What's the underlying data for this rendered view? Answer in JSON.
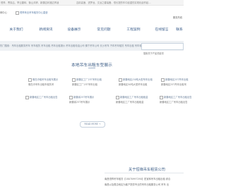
{
  "topbar": {
    "items": [
      "恒锋、曹操吕、擎云翻转、衡山鸿锋、新疆吉利福达锋凌",
      "吉精高速、进梦龙、文远之春装备、恒长提的车中起重的实现化起作起…"
    ]
  },
  "header": {
    "site_id": "网中心",
    "logo_alt": "恒锋商业吊车租赁中心直营",
    "service_phone": "服务热线"
  },
  "nav": {
    "items": [
      "关于我们",
      "新闻资讯",
      "设备展示",
      "常见问题",
      "工程案例",
      "在线留言",
      "联系"
    ]
  },
  "hotline": {
    "label": "热门搜索：吊车出租服务吊车 吊车租赁 吊车出租 吊车出租报价 吊车出租电话公司 佛宁吊车公司 长沙吊车 汽车吊车租赁 吊车出租 吊车租赁公司 福达吊车出租",
    "search_placeholder": "搜索关于产品关键词"
  },
  "showcase": {
    "title": "本地吊车出租车型展示",
    "cards": [
      {
        "title": "佛岛冷租吊车出租车展示",
        "caption": "佛岛冷吊车出租车租赁吊"
      },
      {
        "title": "新疆区工厂25T吊车出租",
        "caption": "新疆区工厂25T吊车出租"
      },
      {
        "title": "新疆地区(50吨大型吊车出租",
        "caption": "新疆地区50吨大型吊车出租"
      },
      {
        "title": "新疆地区25T吊车出租",
        "caption": "新疆地区25T吊车出租吊"
      },
      {
        "title": "新疆地区工厂吊车出租出售",
        "caption": ""
      },
      {
        "title": "新疆省25T吊车展示",
        "caption": "新疆省25T吊车展示"
      },
      {
        "title": "新疆地区工厂吊车出租租金",
        "caption": "新疆地区工厂吊车出租租金"
      },
      {
        "title": "新疆地区工厂吊车出租出售",
        "caption": "新疆地区工厂吊车出租出售"
      },
      {
        "title": "南省省25T吊吊车出租公司",
        "caption": "南省25T吊车出租公司"
      },
      {
        "title": "新疆地区工厂吊车出租出售",
        "caption": "新疆地区吊车出租展示"
      }
    ],
    "read_more": "READ MORE →"
  },
  "about": {
    "title": "关于恒锋吊车租赁公司",
    "lines": [
      "南昌恒锋吊车租赁【18070997290】是宣和吊车出租出租 综合",
      "南昌以及周边地区为客户提供专业的吊车出租服务公司 吊车 出"
    ]
  }
}
